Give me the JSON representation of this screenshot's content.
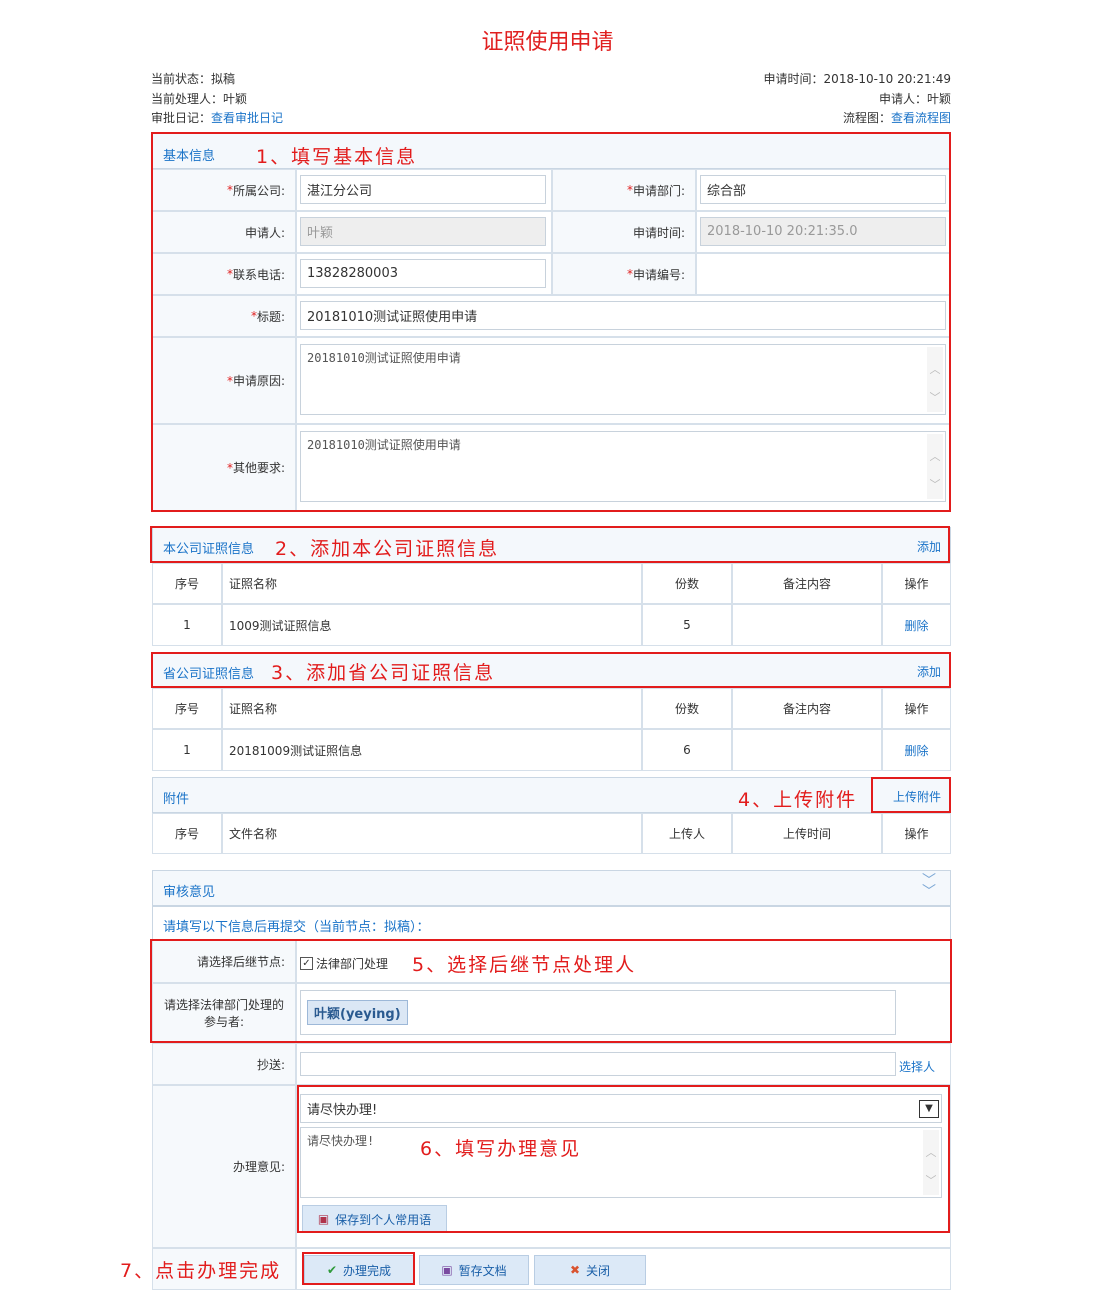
{
  "page_title": "证照使用申请",
  "meta": {
    "status_label": "当前状态：",
    "status_value": "拟稿",
    "handler_label": "当前处理人：",
    "handler_value": "叶颖",
    "log_label": "审批日记：",
    "log_link": "查看审批日记",
    "time_label": "申请时间：",
    "time_value": "2018-10-10 20:21:49",
    "applicant_label": "申请人：",
    "applicant_value": "叶颖",
    "flow_label": "流程图：",
    "flow_link": "查看流程图"
  },
  "basic": {
    "header": "基本信息",
    "annotation": "1、填写基本信息",
    "company_label": "所属公司:",
    "company_value": "湛江分公司",
    "dept_label": "申请部门:",
    "dept_value": "综合部",
    "applicant_label": "申请人:",
    "applicant_value": "叶颖",
    "time_label": "申请时间:",
    "time_value": "2018-10-10 20:21:35.0",
    "phone_label": "联系电话:",
    "phone_value": "13828280003",
    "number_label": "申请编号:",
    "number_value": "",
    "title_label": "标题:",
    "title_value": "20181010测试证照使用申请",
    "reason_label": "申请原因:",
    "reason_value": "20181010测试证照使用申请",
    "other_label": "其他要求:",
    "other_value": "20181010测试证照使用申请",
    "required_mark": "*"
  },
  "company_license": {
    "header": "本公司证照信息",
    "annotation": "2、添加本公司证照信息",
    "add": "添加",
    "columns": [
      "序号",
      "证照名称",
      "份数",
      "备注内容",
      "操作"
    ],
    "rows": [
      {
        "no": "1",
        "name": "1009测试证照信息",
        "count": "5",
        "note": "",
        "action": "删除"
      }
    ]
  },
  "province_license": {
    "header": "省公司证照信息",
    "annotation": "3、添加省公司证照信息",
    "add": "添加",
    "columns": [
      "序号",
      "证照名称",
      "份数",
      "备注内容",
      "操作"
    ],
    "rows": [
      {
        "no": "1",
        "name": "20181009测试证照信息",
        "count": "6",
        "note": "",
        "action": "删除"
      }
    ]
  },
  "attachment": {
    "header": "附件",
    "annotation": "4、上传附件",
    "upload": "上传附件",
    "columns": [
      "序号",
      "文件名称",
      "上传人",
      "上传时间",
      "操作"
    ]
  },
  "review": {
    "header": "审核意见",
    "prompt": "请填写以下信息后再提交（当前节点：拟稿）：",
    "next_label": "请选择后继节点:",
    "next_option": "法律部门处理",
    "annotation5": "5、选择后继节点处理人",
    "participant_label": "请选择法律部门处理的参与者:",
    "participant_value": "叶颖(yeying)",
    "cc_label": "抄送:",
    "cc_value": "",
    "cc_link": "选择人",
    "opinion_label": "办理意见:",
    "opinion_select": "请尽快办理!",
    "opinion_text": "请尽快办理!",
    "annotation6": "6、填写办理意见",
    "save_phrase": "保存到个人常用语"
  },
  "actions": {
    "annotation7": "7、点击办理完成",
    "complete": "办理完成",
    "draft": "暂存文档",
    "close": "关闭"
  },
  "colors": {
    "title": "#e02020",
    "link": "#1a73c8",
    "annotation": "#e21c1c"
  }
}
